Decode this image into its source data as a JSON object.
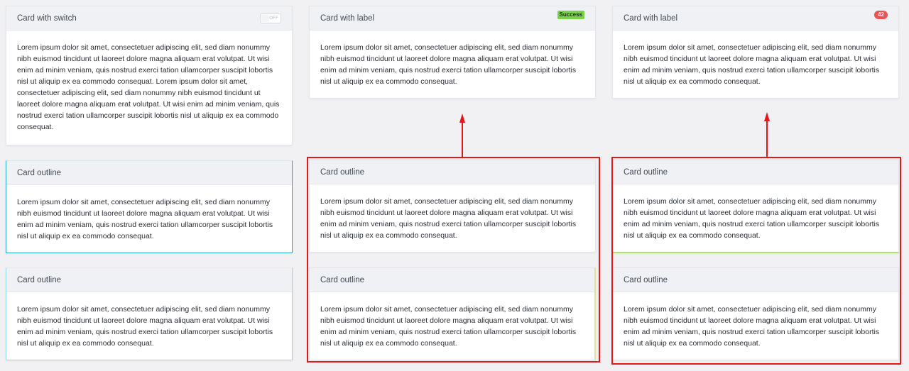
{
  "lorem_long": "Lorem ipsum dolor sit amet, consectetuer adipiscing elit, sed diam nonummy nibh euismod tincidunt ut laoreet dolore magna aliquam erat volutpat. Ut wisi enim ad minim veniam, quis nostrud exerci tation ullamcorper suscipit lobortis nisl ut aliquip ex ea commodo consequat. Lorem ipsum dolor sit amet, consectetuer adipiscing elit, sed diam nonummy nibh euismod tincidunt ut laoreet dolore magna aliquam erat volutpat. Ut wisi enim ad minim veniam, quis nostrud exerci tation ullamcorper suscipit lobortis nisl ut aliquip ex ea commodo consequat.",
  "lorem_short": "Lorem ipsum dolor sit amet, consectetuer adipiscing elit, sed diam nonummy nibh euismod tincidunt ut laoreet dolore magna aliquam erat volutpat. Ut wisi enim ad minim veniam, quis nostrud exerci tation ullamcorper suscipit lobortis nisl ut aliquip ex ea commodo consequat.",
  "cards": {
    "switch_card": {
      "title": "Card with switch",
      "switch_state": "off",
      "switch_text": "OFF"
    },
    "label_success_card": {
      "title": "Card with label",
      "badge": "Success"
    },
    "label_count_card": {
      "title": "Card with label",
      "badge": "42"
    },
    "outline_title": "Card outline"
  },
  "colors": {
    "annotation": "#e6151a",
    "outline_blue": "#2aa8cc",
    "outline_lightblue": "#96d7ef",
    "outline_green": "#b4e06a",
    "outline_yellow": "#e6e194",
    "badge_success": "#7bd148",
    "badge_count": "#ee5253"
  }
}
